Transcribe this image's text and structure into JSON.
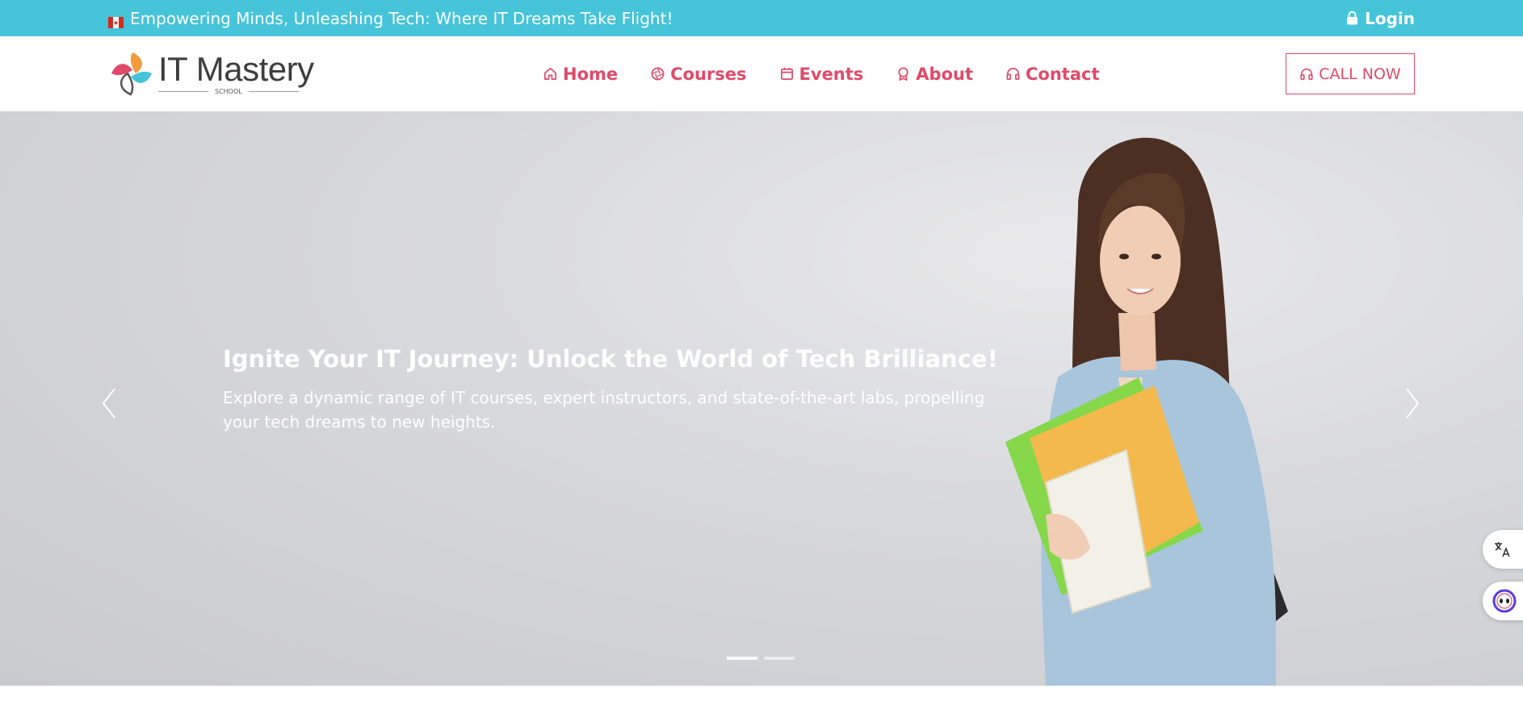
{
  "colors": {
    "topbar": "#45c4da",
    "accent": "#e04a6a",
    "hero_bg": "#d7d8dc"
  },
  "topbar": {
    "tagline": "Empowering Minds, Unleashing Tech: Where IT Dreams Take Flight!",
    "login_label": "Login"
  },
  "header": {
    "logo": {
      "title": "IT Mastery",
      "subtitle": "SCHOOL"
    },
    "nav": [
      {
        "label": "Home",
        "icon": "home-icon"
      },
      {
        "label": "Courses",
        "icon": "aperture-icon"
      },
      {
        "label": "Events",
        "icon": "calendar-icon"
      },
      {
        "label": "About",
        "icon": "award-icon"
      },
      {
        "label": "Contact",
        "icon": "headset-icon"
      }
    ],
    "call_label": "CALL NOW"
  },
  "hero": {
    "title": "Ignite Your IT Journey: Unlock the World of Tech Brilliance!",
    "text": "Explore a dynamic range of IT courses, expert instructors, and state-of-the-art labs, propelling your tech dreams to new heights.",
    "slide_count": 2,
    "active_slide": 1
  },
  "widgets": {
    "translate_icon": "translate-icon",
    "assistant_icon": "assistant-icon"
  }
}
